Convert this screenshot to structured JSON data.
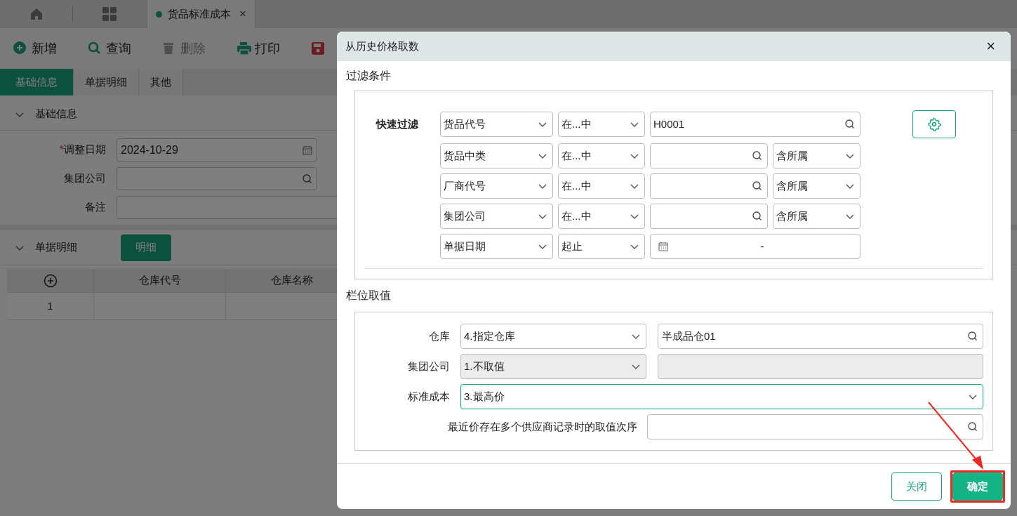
{
  "app_tabs": [
    {
      "kind": "home"
    },
    {
      "kind": "grid"
    },
    {
      "kind": "page",
      "label": "货品标准成本",
      "selected": true,
      "close": "×"
    }
  ],
  "toolbar": [
    {
      "kind": "add",
      "label": "新增",
      "disabled": false
    },
    {
      "kind": "search",
      "label": "查询",
      "disabled": false
    },
    {
      "kind": "delete",
      "label": "删除",
      "disabled": true
    },
    {
      "kind": "print",
      "label": "打印",
      "disabled": false
    },
    {
      "kind": "save",
      "disabled": false
    }
  ],
  "form_tabs": [
    {
      "label": "基础信息",
      "selected": true
    },
    {
      "label": "单据明细",
      "selected": false
    },
    {
      "label": "其他",
      "selected": false
    }
  ],
  "basic_section": {
    "title": "基础信息",
    "expanded": true,
    "fields": [
      {
        "label": "调整日期",
        "required_mark": "*",
        "kind": "date",
        "value": "2024-10-29"
      },
      {
        "label": "集团公司",
        "kind": "lookup"
      },
      {
        "label": "备注",
        "kind": "text"
      }
    ]
  },
  "detail_section": {
    "title": "单据明细",
    "expanded": true,
    "button": "明细",
    "table": {
      "columns": [
        "仓库代号",
        "仓库名称"
      ],
      "rows": [
        {
          "index": "1"
        }
      ]
    }
  },
  "dialog": {
    "title": "从历史价格取数",
    "close": "×",
    "filter_heading": "过滤条件",
    "quick_filter_label": "快速过滤",
    "filters": [
      {
        "field": "货品代号",
        "operator": "在...中",
        "kind": "lookup",
        "value": "H0001"
      },
      {
        "field": "货品中类",
        "operator": "在...中",
        "kind": "lookup",
        "scope": "含所属"
      },
      {
        "field": "厂商代号",
        "operator": "在...中",
        "kind": "lookup",
        "scope": "含所属"
      },
      {
        "field": "集团公司",
        "operator": "在...中",
        "kind": "lookup",
        "scope": "含所属"
      },
      {
        "field": "单据日期",
        "operator": "起止",
        "kind": "date_range",
        "separator": "-"
      }
    ],
    "values_heading": "栏位取值",
    "value_rows": [
      {
        "label": "仓库",
        "kind": "mode_lookup",
        "mode": "4.指定仓库",
        "value": "半成品仓01",
        "disabled": false,
        "focused": false
      },
      {
        "label": "集团公司",
        "kind": "mode_lookup",
        "mode": "1.不取值",
        "disabled": true,
        "focused": false
      },
      {
        "label": "标准成本",
        "kind": "mode",
        "mode": "3.最高价",
        "disabled": false,
        "focused": true
      },
      {
        "label": "最近价存在多个供应商记录时的取值次序",
        "kind": "lookup",
        "disabled": false,
        "focused": false
      }
    ],
    "buttons": [
      {
        "label": "关闭",
        "kind": "secondary",
        "highlighted": false
      },
      {
        "label": "确定",
        "kind": "primary",
        "highlighted": true
      }
    ]
  }
}
